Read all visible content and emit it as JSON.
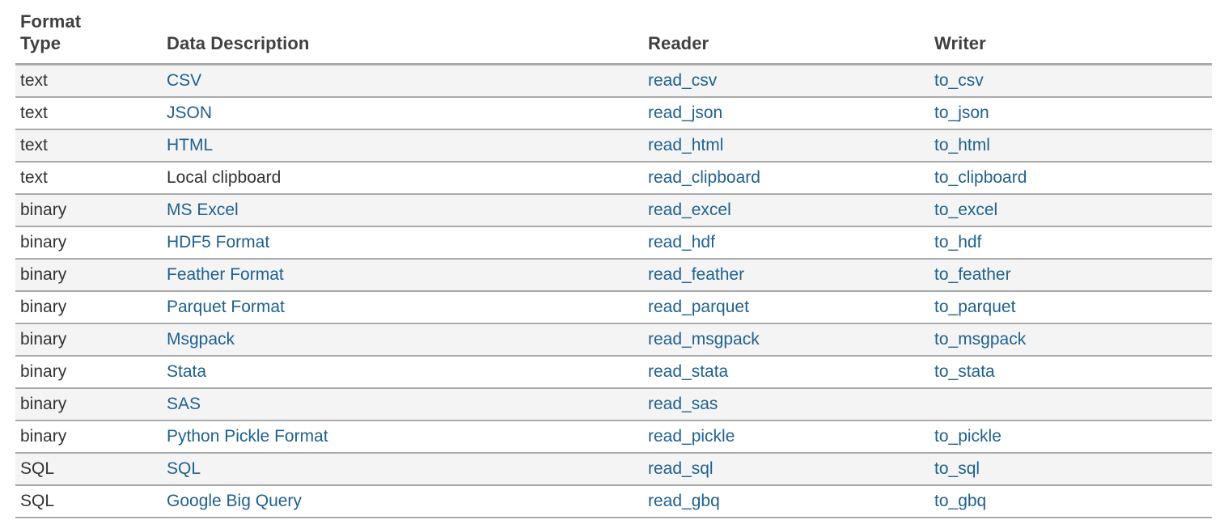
{
  "table": {
    "columns": [
      {
        "key": "format_type",
        "label_lines": [
          "Format",
          "Type"
        ],
        "label": "Format Type"
      },
      {
        "key": "data_description",
        "label": "Data Description"
      },
      {
        "key": "reader",
        "label": "Reader"
      },
      {
        "key": "writer",
        "label": "Writer"
      }
    ],
    "link_color": "#20618f",
    "text_color": "#333333",
    "header_color": "#404040",
    "row_alt_background": "#f4f4f4",
    "row_background": "#ffffff",
    "border_color": "#aaaaaa",
    "rows": [
      {
        "format_type": "text",
        "data_description": "CSV",
        "desc_is_link": true,
        "reader": "read_csv",
        "writer": "to_csv"
      },
      {
        "format_type": "text",
        "data_description": "JSON",
        "desc_is_link": true,
        "reader": "read_json",
        "writer": "to_json"
      },
      {
        "format_type": "text",
        "data_description": "HTML",
        "desc_is_link": true,
        "reader": "read_html",
        "writer": "to_html"
      },
      {
        "format_type": "text",
        "data_description": "Local clipboard",
        "desc_is_link": false,
        "reader": "read_clipboard",
        "writer": "to_clipboard"
      },
      {
        "format_type": "binary",
        "data_description": "MS Excel",
        "desc_is_link": true,
        "reader": "read_excel",
        "writer": "to_excel"
      },
      {
        "format_type": "binary",
        "data_description": "HDF5 Format",
        "desc_is_link": true,
        "reader": "read_hdf",
        "writer": "to_hdf"
      },
      {
        "format_type": "binary",
        "data_description": "Feather Format",
        "desc_is_link": true,
        "reader": "read_feather",
        "writer": "to_feather"
      },
      {
        "format_type": "binary",
        "data_description": "Parquet Format",
        "desc_is_link": true,
        "reader": "read_parquet",
        "writer": "to_parquet"
      },
      {
        "format_type": "binary",
        "data_description": "Msgpack",
        "desc_is_link": true,
        "reader": "read_msgpack",
        "writer": "to_msgpack"
      },
      {
        "format_type": "binary",
        "data_description": "Stata",
        "desc_is_link": true,
        "reader": "read_stata",
        "writer": "to_stata"
      },
      {
        "format_type": "binary",
        "data_description": "SAS",
        "desc_is_link": true,
        "reader": "read_sas",
        "writer": ""
      },
      {
        "format_type": "binary",
        "data_description": "Python Pickle Format",
        "desc_is_link": true,
        "reader": "read_pickle",
        "writer": "to_pickle"
      },
      {
        "format_type": "SQL",
        "data_description": "SQL",
        "desc_is_link": true,
        "reader": "read_sql",
        "writer": "to_sql"
      },
      {
        "format_type": "SQL",
        "data_description": "Google Big Query",
        "desc_is_link": true,
        "reader": "read_gbq",
        "writer": "to_gbq"
      }
    ]
  }
}
